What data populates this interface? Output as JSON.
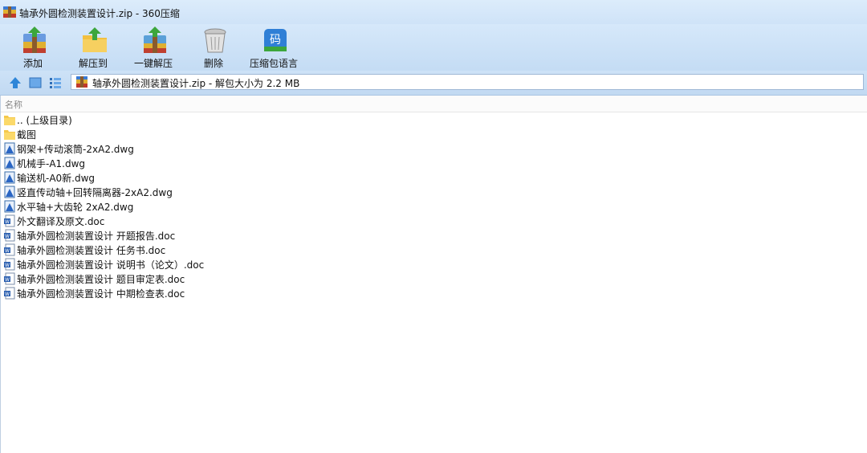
{
  "window": {
    "title": "轴承外圆检测装置设计.zip - 360压缩"
  },
  "toolbar": {
    "items": [
      {
        "label": "添加",
        "icon": "add-archive-icon"
      },
      {
        "label": "解压到",
        "icon": "extract-to-icon"
      },
      {
        "label": "一键解压",
        "icon": "one-click-extract-icon"
      },
      {
        "label": "删除",
        "icon": "trash-icon"
      },
      {
        "label": "压缩包语言",
        "icon": "encoding-icon",
        "glyph": "码"
      }
    ]
  },
  "address": {
    "text": "轴承外圆检测装置设计.zip - 解包大小为 2.2 MB"
  },
  "list": {
    "column_name": "名称",
    "files": [
      {
        "name": ".. (上级目录)",
        "type": "folder"
      },
      {
        "name": "截图",
        "type": "folder"
      },
      {
        "name": "钢架+传动滚筒-2xA2.dwg",
        "type": "dwg"
      },
      {
        "name": "机械手-A1.dwg",
        "type": "dwg"
      },
      {
        "name": "输送机-A0新.dwg",
        "type": "dwg"
      },
      {
        "name": "竖直传动轴+回转隔离器-2xA2.dwg",
        "type": "dwg"
      },
      {
        "name": "水平轴+大齿轮 2xA2.dwg",
        "type": "dwg"
      },
      {
        "name": "外文翻译及原文.doc",
        "type": "doc"
      },
      {
        "name": "轴承外圆检测装置设计 开题报告.doc",
        "type": "doc"
      },
      {
        "name": "轴承外圆检测装置设计 任务书.doc",
        "type": "doc"
      },
      {
        "name": "轴承外圆检测装置设计 说明书（论文）.doc",
        "type": "doc"
      },
      {
        "name": "轴承外圆检测装置设计 题目审定表.doc",
        "type": "doc"
      },
      {
        "name": "轴承外圆检测装置设计 中期检查表.doc",
        "type": "doc"
      }
    ]
  }
}
